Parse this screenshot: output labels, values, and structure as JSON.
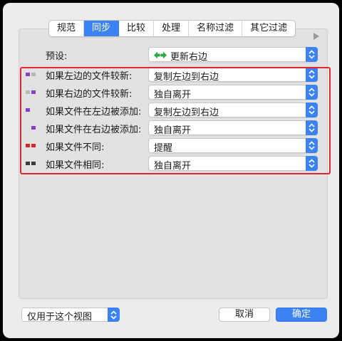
{
  "tabs": [
    {
      "label": "规范",
      "active": false
    },
    {
      "label": "同步",
      "active": true
    },
    {
      "label": "比较",
      "active": false
    },
    {
      "label": "处理",
      "active": false
    },
    {
      "label": "名称过滤",
      "active": false
    },
    {
      "label": "其它过滤",
      "active": false
    }
  ],
  "preset": {
    "label": "预设:",
    "value": "更新右边",
    "icon": "green-sync-arrows-icon"
  },
  "rules": [
    {
      "label": "如果左边的文件较新:",
      "value": "复制左边到右边",
      "swatch_left": "#8a3fc8",
      "swatch_right": "#b7b7b7"
    },
    {
      "label": "如果右边的文件较新:",
      "value": "独自离开",
      "swatch_left": "#b7b7b7",
      "swatch_right": "#8a3fc8"
    },
    {
      "label": "如果文件在左边被添加:",
      "value": "复制左边到右边",
      "swatch_left": "#8a3fc8",
      "swatch_right": null
    },
    {
      "label": "如果文件在右边被添加:",
      "value": "独自离开",
      "swatch_left": null,
      "swatch_right": "#8a3fc8"
    },
    {
      "label": "如果文件不同:",
      "value": "提醒",
      "swatch_left": "#d8262b",
      "swatch_right": "#d8262b"
    },
    {
      "label": "如果文件相同:",
      "value": "独自离开",
      "swatch_left": "#3a3a3a",
      "swatch_right": "#3a3a3a"
    }
  ],
  "footer": {
    "view_scope": "仅用于这个视图",
    "cancel_label": "取消",
    "ok_label": "确定"
  },
  "colors": {
    "accent": "#3b82f5",
    "highlight": "#e0262b"
  }
}
